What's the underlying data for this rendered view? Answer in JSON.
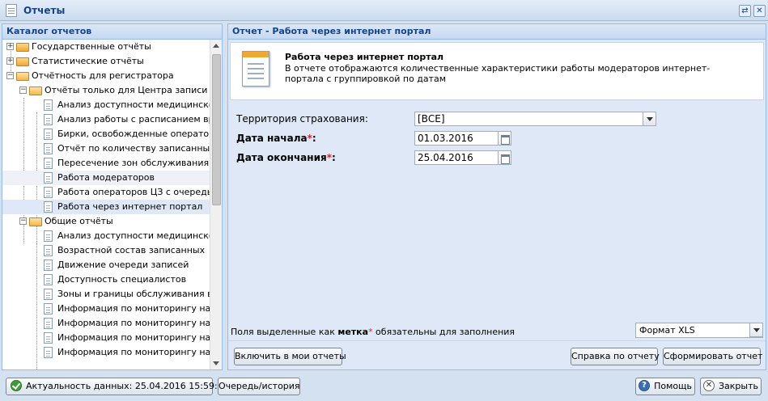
{
  "window": {
    "title": "Отчеты"
  },
  "catalog": {
    "header": "Каталог отчетов",
    "items": [
      {
        "label": "Государственные отчёты"
      },
      {
        "label": "Статистические отчёты"
      },
      {
        "label": "Отчётность для регистратора"
      },
      {
        "label": "Отчёты только для Центра записи"
      },
      {
        "label": "Анализ доступности медицинской по"
      },
      {
        "label": "Анализ работы с расписанием врача"
      },
      {
        "label": "Бирки, освобожденные операторами"
      },
      {
        "label": "Отчёт по количеству записанных св"
      },
      {
        "label": "Пересечение зон обслуживания"
      },
      {
        "label": "Работа модераторов"
      },
      {
        "label": "Работа операторов ЦЗ с очередью за"
      },
      {
        "label": "Работа через интернет портал"
      },
      {
        "label": "Общие отчёты"
      },
      {
        "label": "Анализ доступности медицинской по"
      },
      {
        "label": "Возрастной состав записанных"
      },
      {
        "label": "Движение очереди записей"
      },
      {
        "label": "Доступность специалистов"
      },
      {
        "label": "Зоны и границы обслуживания врачи"
      },
      {
        "label": "Информация по мониторингу направ"
      },
      {
        "label": "Информация по мониторингу направ"
      },
      {
        "label": "Информация по мониторингу направ"
      },
      {
        "label": "Информация по мониторингу направ"
      }
    ]
  },
  "report": {
    "header": "Отчет - Работа через интернет портал",
    "title": "Работа через интернет портал",
    "description": "В отчете отображаются количественные характеристики работы модераторов интернет-портала с группировкой по датам",
    "fields": {
      "territory_label": "Территория страхования:",
      "territory_value": "[ВСЕ]",
      "start_label": "Дата начала",
      "start_value": "01.03.2016",
      "end_label": "Дата окончания",
      "end_value": "25.04.2016",
      "required_mark": "*",
      "colon": ":"
    },
    "note": {
      "prefix": "Поля выделенные как ",
      "bold": "метка",
      "mark": "*",
      "suffix": " обязательны для заполнения"
    },
    "format": "Формат XLS",
    "buttons": {
      "include": "Включить в мои отчеты",
      "help": "Справка по отчету",
      "generate": "Сформировать отчет"
    }
  },
  "statusbar": {
    "actuality": "Актуальность данных: 25.04.2016 15:59:26",
    "queue": "Очередь/история",
    "help": "Помощь",
    "close": "Закрыть"
  },
  "icons": {
    "help_glyph": "?",
    "close_glyph": "✕",
    "restore_glyph": "⇄",
    "window_close_glyph": "✕"
  }
}
